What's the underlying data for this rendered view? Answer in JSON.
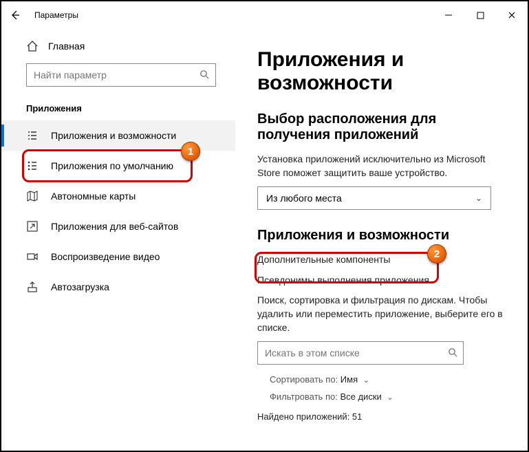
{
  "titlebar": {
    "title": "Параметры"
  },
  "sidebar": {
    "home": "Главная",
    "search_placeholder": "Найти параметр",
    "section": "Приложения",
    "items": [
      {
        "label": "Приложения и возможности",
        "icon": "list-icon",
        "active": true
      },
      {
        "label": "Приложения по умолчанию",
        "icon": "bullet-list-icon"
      },
      {
        "label": "Автономные карты",
        "icon": "map-icon"
      },
      {
        "label": "Приложения для веб-сайтов",
        "icon": "launch-icon"
      },
      {
        "label": "Воспроизведение видео",
        "icon": "video-icon"
      },
      {
        "label": "Автозагрузка",
        "icon": "autostart-icon"
      }
    ]
  },
  "main": {
    "h1": "Приложения и возможности",
    "section1": {
      "heading": "Выбор расположения для получения приложений",
      "desc": "Установка приложений исключительно из Microsoft Store поможет защитить ваше устройство.",
      "dropdown_value": "Из любого места"
    },
    "section2": {
      "heading": "Приложения и возможности",
      "link1": "Дополнительные компоненты",
      "link2": "Псевдонимы выполнения приложения",
      "desc": "Поиск, сортировка и фильтрация по дискам. Чтобы удалить или переместить приложение, выберите его в списке.",
      "search_placeholder": "Искать в этом списке",
      "sort_label": "Сортировать по:",
      "sort_value": "Имя",
      "filter_label": "Фильтровать по:",
      "filter_value": "Все диски",
      "found_label": "Найдено приложений: 51"
    }
  },
  "callouts": {
    "n1": "1",
    "n2": "2"
  }
}
